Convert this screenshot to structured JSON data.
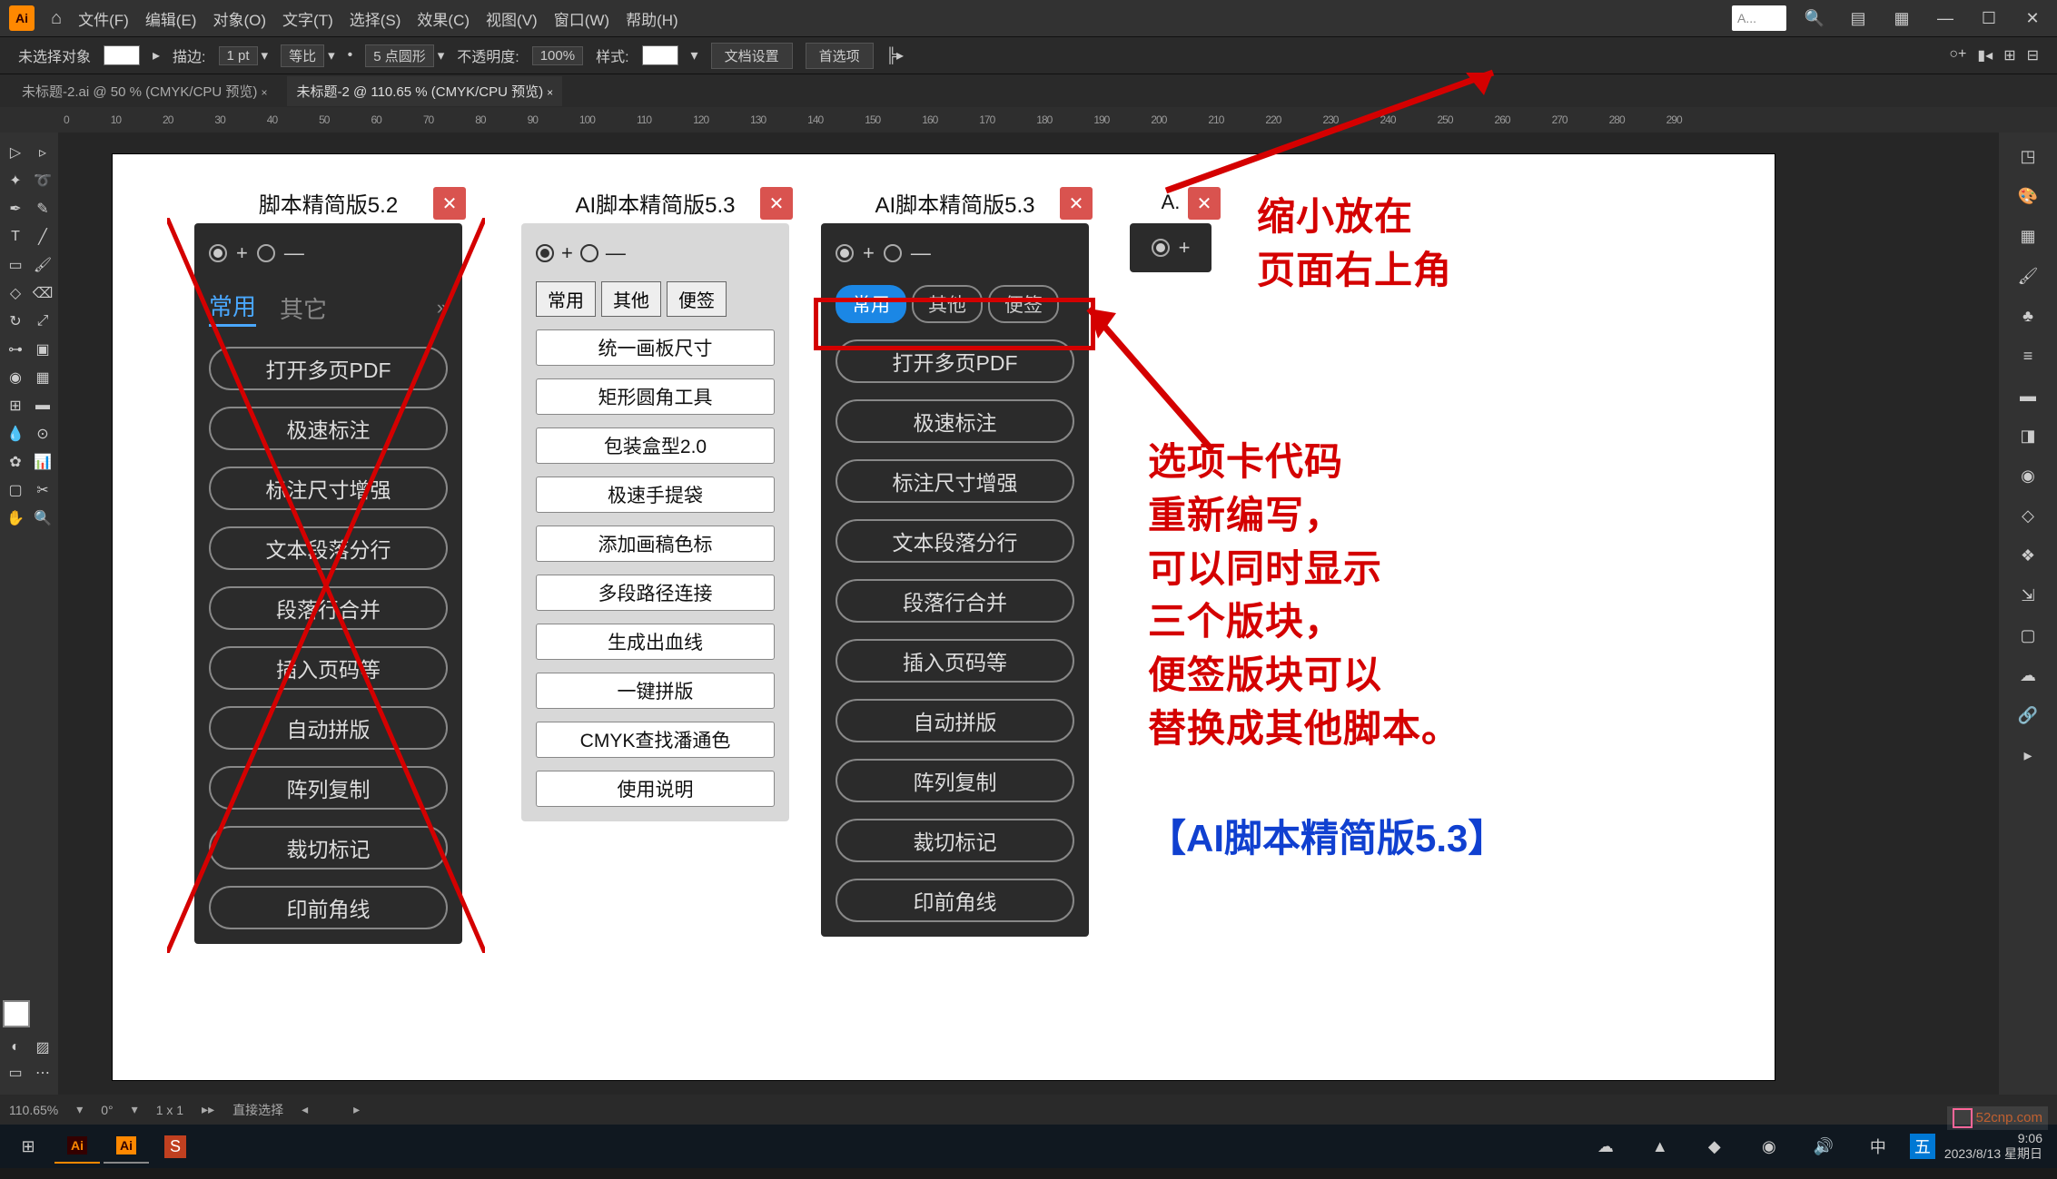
{
  "menubar": {
    "items": [
      "文件(F)",
      "编辑(E)",
      "对象(O)",
      "文字(T)",
      "选择(S)",
      "效果(C)",
      "视图(V)",
      "窗口(W)",
      "帮助(H)"
    ],
    "searchPlaceholder": "A..."
  },
  "options": {
    "noSelection": "未选择对象",
    "stroke": "描边:",
    "strokeVal": "1 pt",
    "uniform": "等比",
    "round": "5 点圆形",
    "opacity": "不透明度:",
    "opacityVal": "100%",
    "style": "样式:",
    "docSetup": "文档设置",
    "prefs": "首选项"
  },
  "tabs": {
    "t1": "未标题-2.ai @ 50 % (CMYK/CPU 预览)",
    "t2": "未标题-2 @ 110.65 % (CMYK/CPU 预览)",
    "t1x": "×",
    "t2x": "×"
  },
  "panel1": {
    "title": "脚本精简版5.2",
    "tabs": [
      "常用",
      "其它"
    ],
    "items": [
      "打开多页PDF",
      "极速标注",
      "标注尺寸增强",
      "文本段落分行",
      "段落行合并",
      "插入页码等",
      "自动拼版",
      "阵列复制",
      "裁切标记",
      "印前角线"
    ]
  },
  "panel2": {
    "title": "AI脚本精简版5.3",
    "tabs": [
      "常用",
      "其他",
      "便签"
    ],
    "items": [
      "统一画板尺寸",
      "矩形圆角工具",
      "包装盒型2.0",
      "极速手提袋",
      "添加画稿色标",
      "多段路径连接",
      "生成出血线",
      "一键拼版",
      "CMYK查找潘通色",
      "使用说明"
    ]
  },
  "panel3": {
    "title": "AI脚本精简版5.3",
    "tabs": [
      "常用",
      "其他",
      "便签"
    ],
    "items": [
      "打开多页PDF",
      "极速标注",
      "标注尺寸增强",
      "文本段落分行",
      "段落行合并",
      "插入页码等",
      "自动拼版",
      "阵列复制",
      "裁切标记",
      "印前角线"
    ]
  },
  "panel4": {
    "title": "A.",
    "ctrl": "+"
  },
  "anno1a": "缩小放在",
  "anno1b": "页面右上角",
  "anno2text": "选项卡代码\n重新编写，\n可以同时显示\n三个版块，\n便签版块可以\n替换成其他脚本。",
  "anno3": "【AI脚本精简版5.3】",
  "status": {
    "zoom": "110.65%",
    "angle": "0°",
    "info": "1 x 1",
    "tool": "直接选择"
  },
  "clock": {
    "time": "9:06",
    "date": "2023/8/13 星期日"
  },
  "ruler": [
    "0",
    "10",
    "20",
    "30",
    "40",
    "50",
    "60",
    "70",
    "80",
    "90",
    "100",
    "110",
    "120",
    "130",
    "140",
    "150",
    "160",
    "170",
    "180",
    "190",
    "200",
    "210",
    "220",
    "230",
    "240",
    "250",
    "260",
    "270",
    "280",
    "290"
  ],
  "watermark": "52cnp.com"
}
